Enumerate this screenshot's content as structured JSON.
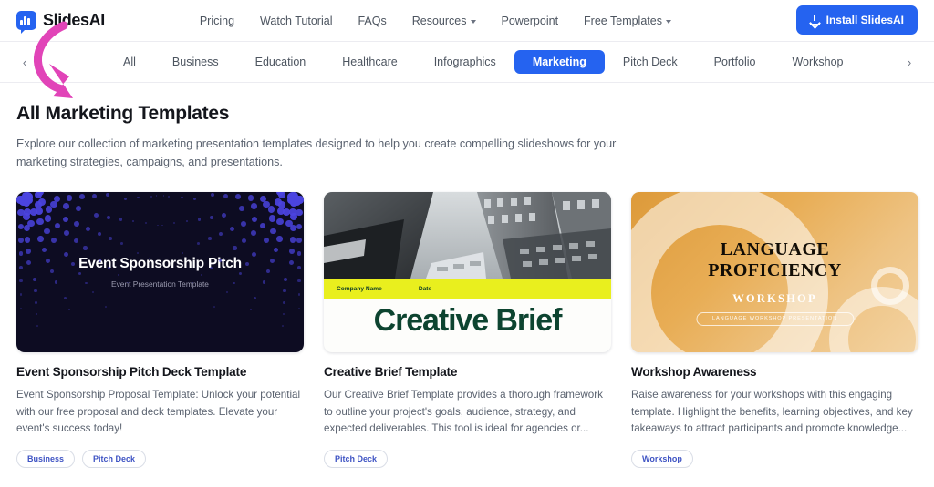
{
  "brand": {
    "name": "SlidesAI",
    "logo_icon": "slides-bar-chart-bubble-icon",
    "accent": "#2563f0"
  },
  "nav": {
    "links": [
      {
        "label": "Pricing",
        "has_caret": false
      },
      {
        "label": "Watch Tutorial",
        "has_caret": false
      },
      {
        "label": "FAQs",
        "has_caret": false
      },
      {
        "label": "Resources",
        "has_caret": true
      },
      {
        "label": "Powerpoint",
        "has_caret": false
      },
      {
        "label": "Free Templates",
        "has_caret": true
      }
    ],
    "install_button": {
      "label": "Install SlidesAI",
      "icon": "download-icon"
    }
  },
  "categories": {
    "prev_icon": "chevron-left-icon",
    "next_icon": "chevron-right-icon",
    "items": [
      {
        "label": "All",
        "active": false
      },
      {
        "label": "Business",
        "active": false
      },
      {
        "label": "Education",
        "active": false
      },
      {
        "label": "Healthcare",
        "active": false
      },
      {
        "label": "Infographics",
        "active": false
      },
      {
        "label": "Marketing",
        "active": true
      },
      {
        "label": "Pitch Deck",
        "active": false
      },
      {
        "label": "Portfolio",
        "active": false
      },
      {
        "label": "Workshop",
        "active": false
      }
    ]
  },
  "page": {
    "title": "All Marketing Templates",
    "description": "Explore our collection of marketing presentation templates designed to help you create compelling slideshows for your marketing strategies, campaigns, and presentations."
  },
  "annotation": {
    "type": "curved-arrow",
    "color": "#e144b8"
  },
  "cards": [
    {
      "title": "Event Sponsorship Pitch Deck Template",
      "description": "Event Sponsorship Proposal Template: Unlock your potential with our free proposal and deck templates. Elevate your event's success today!",
      "tags": [
        "Business",
        "Pitch Deck"
      ],
      "thumb": {
        "style": "dark-dotted",
        "bg": "#0d0c22",
        "dot_color": "#4b44e0",
        "headline": "Event Sponsorship Pitch",
        "subhead": "Event Presentation Template"
      }
    },
    {
      "title": "Creative Brief Template",
      "description": "Our Creative Brief Template provides a thorough framework to outline your project's goals, audience, strategy, and expected deliverables. This tool is ideal for agencies or...",
      "tags": [
        "Pitch Deck"
      ],
      "thumb": {
        "style": "photo-band",
        "band_color": "#e9ef1e",
        "text_color": "#0d4430",
        "band_left": "Company Name",
        "band_right": "Date",
        "headline": "Creative Brief"
      }
    },
    {
      "title": "Workshop Awareness",
      "description": "Raise awareness for your workshops with this engaging template. Highlight the benefits, learning objectives, and key takeaways to attract participants and promote knowledge...",
      "tags": [
        "Workshop"
      ],
      "thumb": {
        "style": "orange-rings",
        "bg": "#e8ad55",
        "line1": "LANGUAGE",
        "line2": "PROFICIENCY",
        "line3": "WORKSHOP",
        "pill": "LANGUAGE WORKSHOP PRESENTATION"
      }
    }
  ]
}
